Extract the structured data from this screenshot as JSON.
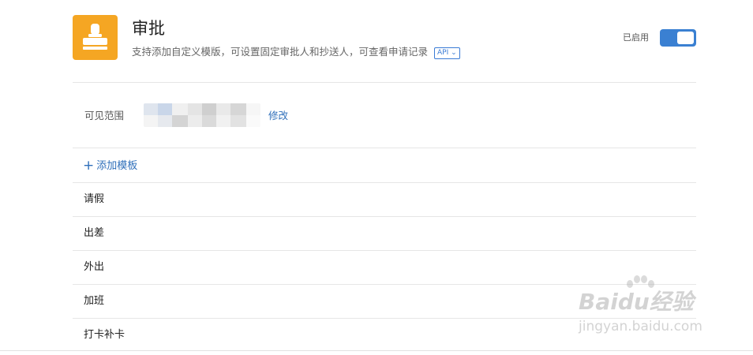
{
  "app": {
    "title": "审批",
    "description": "支持添加自定义模版，可设置固定审批人和抄送人，可查看申请记录",
    "api_badge": "API ⌄",
    "status_label": "已启用",
    "toggle_on": true,
    "icon": "stamp-icon",
    "icon_color": "#f5a623"
  },
  "scope": {
    "label": "可见范围",
    "modify_label": "修改"
  },
  "templates": {
    "add_label": "添加模板",
    "add_icon": "plus-icon",
    "items": [
      "请假",
      "出差",
      "外出",
      "加班",
      "打卡补卡"
    ]
  },
  "watermark": {
    "logo_text": "Baidu经验",
    "url": "jingyan.baidu.com"
  },
  "colors": {
    "accent": "#3a80d2",
    "link": "#2f6fba",
    "divider": "#e6e6e6"
  }
}
